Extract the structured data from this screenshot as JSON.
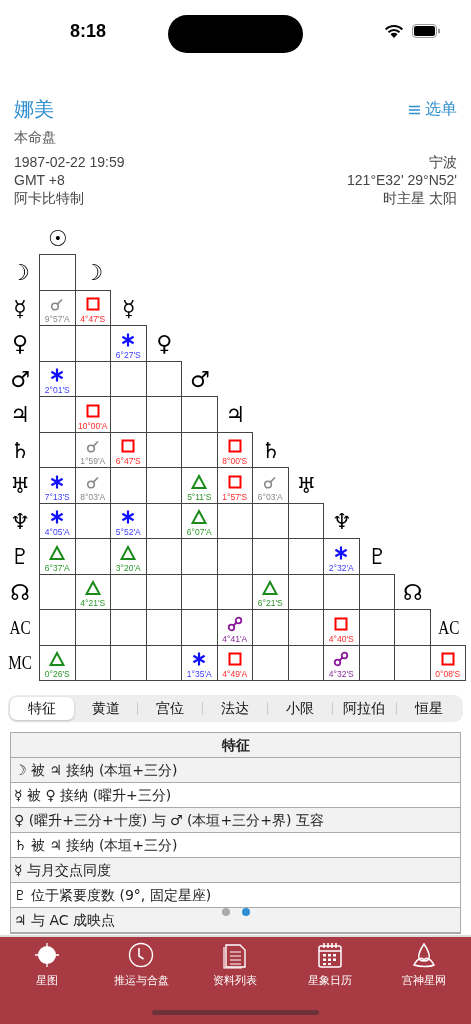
{
  "status_bar": {
    "time": "8:18"
  },
  "header": {
    "title": "娜美",
    "menu_label": "选单",
    "chart_type": "本命盘",
    "left_lines": [
      "1987-02-22 19:59",
      "GMT +8",
      "阿卡比特制"
    ],
    "right_lines": [
      "宁波",
      "121°E32' 29°N52'",
      "时主星 太阳"
    ]
  },
  "aspect_grid": {
    "top_point": "☉",
    "rows": [
      {
        "point": "☽",
        "diagonal_point": "☽",
        "cells": [
          {
            "kind": "empty"
          }
        ]
      },
      {
        "point": "☿",
        "diagonal_point": "☿",
        "cells": [
          {
            "kind": "conjunction",
            "orb": "9°57'A"
          },
          {
            "kind": "square",
            "orb": "4°47'S"
          }
        ]
      },
      {
        "point": "♀",
        "diagonal_point": "♀",
        "cells": [
          {
            "kind": "empty"
          },
          {
            "kind": "empty"
          },
          {
            "kind": "sextile",
            "orb": "6°27'S"
          }
        ]
      },
      {
        "point": "♂",
        "diagonal_point": "♂",
        "cells": [
          {
            "kind": "sextile",
            "orb": "2°01'S"
          },
          {
            "kind": "empty"
          },
          {
            "kind": "empty"
          },
          {
            "kind": "empty"
          }
        ]
      },
      {
        "point": "♃",
        "diagonal_point": "♃",
        "cells": [
          {
            "kind": "empty"
          },
          {
            "kind": "square",
            "orb": "10°00'A"
          },
          {
            "kind": "empty"
          },
          {
            "kind": "empty"
          },
          {
            "kind": "empty"
          }
        ]
      },
      {
        "point": "♄",
        "diagonal_point": "♄",
        "cells": [
          {
            "kind": "empty"
          },
          {
            "kind": "conjunction",
            "orb": "1°59'A"
          },
          {
            "kind": "square",
            "orb": "6°47'S"
          },
          {
            "kind": "empty"
          },
          {
            "kind": "empty"
          },
          {
            "kind": "square",
            "orb": "8°00'S"
          }
        ]
      },
      {
        "point": "♅",
        "diagonal_point": "♅",
        "cells": [
          {
            "kind": "sextile",
            "orb": "7°13'S"
          },
          {
            "kind": "conjunction",
            "orb": "8°03'A"
          },
          {
            "kind": "empty"
          },
          {
            "kind": "empty"
          },
          {
            "kind": "trine",
            "orb": "5°11'S"
          },
          {
            "kind": "square",
            "orb": "1°57'S"
          },
          {
            "kind": "conjunction",
            "orb": "6°03'A"
          }
        ]
      },
      {
        "point": "♆",
        "diagonal_point": "♆",
        "cells": [
          {
            "kind": "sextile",
            "orb": "4°05'A"
          },
          {
            "kind": "empty"
          },
          {
            "kind": "sextile",
            "orb": "5°52'A"
          },
          {
            "kind": "empty"
          },
          {
            "kind": "trine",
            "orb": "6°07'A"
          },
          {
            "kind": "empty"
          },
          {
            "kind": "empty"
          },
          {
            "kind": "empty"
          }
        ]
      },
      {
        "point": "♇",
        "diagonal_point": "♇",
        "cells": [
          {
            "kind": "trine",
            "orb": "6°37'A"
          },
          {
            "kind": "empty"
          },
          {
            "kind": "trine",
            "orb": "3°20'A"
          },
          {
            "kind": "empty"
          },
          {
            "kind": "empty"
          },
          {
            "kind": "empty"
          },
          {
            "kind": "empty"
          },
          {
            "kind": "empty"
          },
          {
            "kind": "sextile",
            "orb": "2°32'A"
          }
        ]
      },
      {
        "point": "☊",
        "diagonal_point": "☊",
        "cells": [
          {
            "kind": "empty"
          },
          {
            "kind": "trine",
            "orb": "4°21'S"
          },
          {
            "kind": "empty"
          },
          {
            "kind": "empty"
          },
          {
            "kind": "empty"
          },
          {
            "kind": "empty"
          },
          {
            "kind": "trine",
            "orb": "6°21'S"
          },
          {
            "kind": "empty"
          },
          {
            "kind": "empty"
          },
          {
            "kind": "empty"
          }
        ]
      },
      {
        "point": "AC",
        "diagonal_point": "AC",
        "cells": [
          {
            "kind": "empty"
          },
          {
            "kind": "empty"
          },
          {
            "kind": "empty"
          },
          {
            "kind": "empty"
          },
          {
            "kind": "empty"
          },
          {
            "kind": "opposition",
            "orb": "4°41'A"
          },
          {
            "kind": "empty"
          },
          {
            "kind": "empty"
          },
          {
            "kind": "square",
            "orb": "4°40'S"
          },
          {
            "kind": "empty"
          },
          {
            "kind": "empty"
          }
        ]
      },
      {
        "point": "MC",
        "cells": [
          {
            "kind": "trine",
            "orb": "0°26'S"
          },
          {
            "kind": "empty"
          },
          {
            "kind": "empty"
          },
          {
            "kind": "empty"
          },
          {
            "kind": "sextile",
            "orb": "1°35'A"
          },
          {
            "kind": "square",
            "orb": "4°49'A"
          },
          {
            "kind": "empty"
          },
          {
            "kind": "empty"
          },
          {
            "kind": "opposition",
            "orb": "4°32'S"
          },
          {
            "kind": "empty"
          },
          {
            "kind": "empty"
          },
          {
            "kind": "square",
            "orb": "0°08'S"
          }
        ]
      }
    ]
  },
  "tabs": [
    {
      "label": "特征",
      "selected": true
    },
    {
      "label": "黄道",
      "selected": false
    },
    {
      "label": "宫位",
      "selected": false
    },
    {
      "label": "法达",
      "selected": false
    },
    {
      "label": "小限",
      "selected": false
    },
    {
      "label": "阿拉伯",
      "selected": false
    },
    {
      "label": "恒星",
      "selected": false
    }
  ],
  "table": {
    "header": "特征",
    "rows": [
      "☽ 被 ♃ 接纳 (本垣+三分)",
      "☿ 被 ♀ 接纳 (曜升+三分)",
      "♀ (曜升+三分+十度) 与 ♂ (本垣+三分+界) 互容",
      "♄ 被 ♃ 接纳 (本垣+三分)",
      "☿ 与月交点同度",
      "♇ 位于紧要度数 (9°, 固定星座)",
      "♃ 与 AC 成映点"
    ]
  },
  "page_dots": [
    {
      "selected": false
    },
    {
      "selected": true
    }
  ],
  "tab_bar": [
    {
      "label": "星图"
    },
    {
      "label": "推运与合盘"
    },
    {
      "label": "资料列表"
    },
    {
      "label": "星象日历"
    },
    {
      "label": "宫神星网"
    }
  ]
}
